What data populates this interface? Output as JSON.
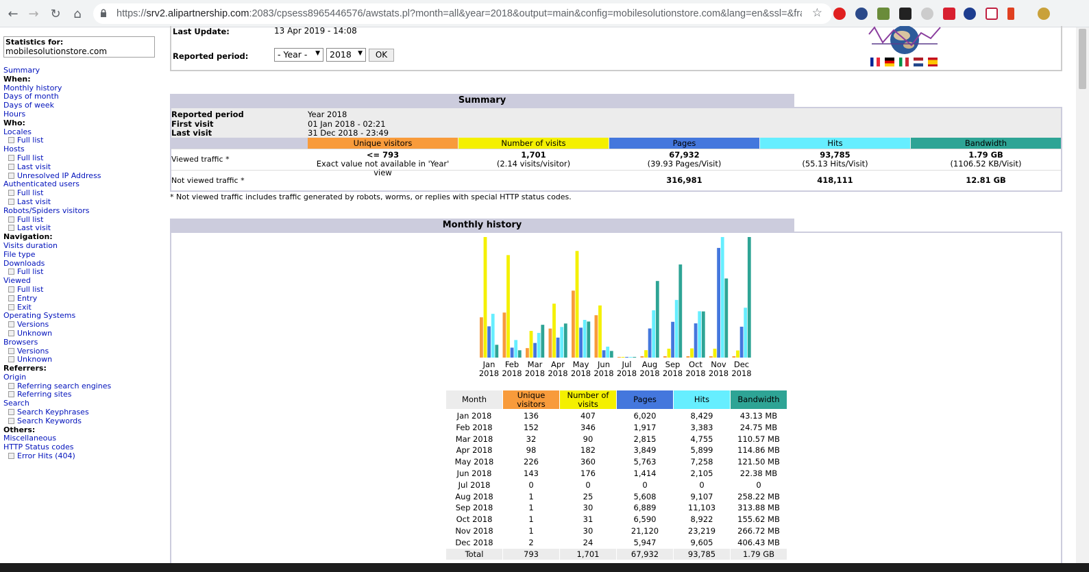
{
  "browser": {
    "url_prefix": "https://",
    "url_host": "srv2.alipartnership.com",
    "url_rest": ":2083/cpsess8965446576/awstats.pl?month=all&year=2018&output=main&config=mobilesolutionstore.com&lang=en&ssl=&fra..."
  },
  "menu": {
    "stats_for_label": "Statistics for:",
    "stats_for_value": "mobilesolutionstore.com",
    "items": [
      {
        "type": "link",
        "label": "Summary"
      },
      {
        "type": "head",
        "label": "When:"
      },
      {
        "type": "link",
        "label": "Monthly history"
      },
      {
        "type": "link",
        "label": "Days of month"
      },
      {
        "type": "link",
        "label": "Days of week"
      },
      {
        "type": "link",
        "label": "Hours"
      },
      {
        "type": "head",
        "label": "Who:"
      },
      {
        "type": "link",
        "label": "Locales"
      },
      {
        "type": "sub",
        "label": "Full list"
      },
      {
        "type": "link",
        "label": "Hosts"
      },
      {
        "type": "sub",
        "label": "Full list"
      },
      {
        "type": "sub",
        "label": "Last visit"
      },
      {
        "type": "sub",
        "label": "Unresolved IP Address"
      },
      {
        "type": "link",
        "label": "Authenticated users"
      },
      {
        "type": "sub",
        "label": "Full list"
      },
      {
        "type": "sub",
        "label": "Last visit"
      },
      {
        "type": "link",
        "label": "Robots/Spiders visitors"
      },
      {
        "type": "sub",
        "label": "Full list"
      },
      {
        "type": "sub",
        "label": "Last visit"
      },
      {
        "type": "head",
        "label": "Navigation:"
      },
      {
        "type": "link",
        "label": "Visits duration"
      },
      {
        "type": "link",
        "label": "File type"
      },
      {
        "type": "link",
        "label": "Downloads"
      },
      {
        "type": "sub",
        "label": "Full list"
      },
      {
        "type": "link",
        "label": "Viewed"
      },
      {
        "type": "sub",
        "label": "Full list"
      },
      {
        "type": "sub",
        "label": "Entry"
      },
      {
        "type": "sub",
        "label": "Exit"
      },
      {
        "type": "link",
        "label": "Operating Systems"
      },
      {
        "type": "sub",
        "label": "Versions"
      },
      {
        "type": "sub",
        "label": "Unknown"
      },
      {
        "type": "link",
        "label": "Browsers"
      },
      {
        "type": "sub",
        "label": "Versions"
      },
      {
        "type": "sub",
        "label": "Unknown"
      },
      {
        "type": "head",
        "label": "Referrers:"
      },
      {
        "type": "link",
        "label": "Origin"
      },
      {
        "type": "sub",
        "label": "Referring search engines"
      },
      {
        "type": "sub",
        "label": "Referring sites"
      },
      {
        "type": "link",
        "label": "Search"
      },
      {
        "type": "sub",
        "label": "Search Keyphrases"
      },
      {
        "type": "sub",
        "label": "Search Keywords"
      },
      {
        "type": "head",
        "label": "Others:"
      },
      {
        "type": "link",
        "label": "Miscellaneous"
      },
      {
        "type": "link",
        "label": "HTTP Status codes"
      },
      {
        "type": "sub",
        "label": "Error Hits (404)"
      }
    ]
  },
  "top": {
    "last_update_label": "Last Update:",
    "last_update_value": "13 Apr 2019 - 14:08",
    "reported_period_label": "Reported period:",
    "period_select": "- Year -",
    "year_select": "2018",
    "ok_label": "OK"
  },
  "summary": {
    "title": "Summary",
    "reported_period_label": "Reported period",
    "reported_period_value": "Year 2018",
    "first_visit_label": "First visit",
    "first_visit_value": "01 Jan 2018 - 02:21",
    "last_visit_label": "Last visit",
    "last_visit_value": "31 Dec 2018 - 23:49",
    "headers": [
      "Unique visitors",
      "Number of visits",
      "Pages",
      "Hits",
      "Bandwidth"
    ],
    "viewed_label": "Viewed traffic *",
    "viewed": [
      {
        "main": "<= 793",
        "sub": "Exact value not available in 'Year' view"
      },
      {
        "main": "1,701",
        "sub": "(2.14 visits/visitor)"
      },
      {
        "main": "67,932",
        "sub": "(39.93 Pages/Visit)"
      },
      {
        "main": "93,785",
        "sub": "(55.13 Hits/Visit)"
      },
      {
        "main": "1.79 GB",
        "sub": "(1106.52 KB/Visit)"
      }
    ],
    "not_viewed_label": "Not viewed traffic *",
    "not_viewed": [
      "316,981",
      "418,111",
      "12.81 GB"
    ],
    "footnote": "* Not viewed traffic includes traffic generated by robots, worms, or replies with special HTTP status codes."
  },
  "monthly": {
    "title": "Monthly history",
    "headers": [
      "Month",
      "Unique visitors",
      "Number of visits",
      "Pages",
      "Hits",
      "Bandwidth"
    ],
    "rows": [
      [
        "Jan 2018",
        "136",
        "407",
        "6,020",
        "8,429",
        "43.13 MB"
      ],
      [
        "Feb 2018",
        "152",
        "346",
        "1,917",
        "3,383",
        "24.75 MB"
      ],
      [
        "Mar 2018",
        "32",
        "90",
        "2,815",
        "4,755",
        "110.57 MB"
      ],
      [
        "Apr 2018",
        "98",
        "182",
        "3,849",
        "5,899",
        "114.86 MB"
      ],
      [
        "May 2018",
        "226",
        "360",
        "5,763",
        "7,258",
        "121.50 MB"
      ],
      [
        "Jun 2018",
        "143",
        "176",
        "1,414",
        "2,105",
        "22.38 MB"
      ],
      [
        "Jul 2018",
        "0",
        "0",
        "0",
        "0",
        "0"
      ],
      [
        "Aug 2018",
        "1",
        "25",
        "5,608",
        "9,107",
        "258.22 MB"
      ],
      [
        "Sep 2018",
        "1",
        "30",
        "6,889",
        "11,103",
        "313.88 MB"
      ],
      [
        "Oct 2018",
        "1",
        "31",
        "6,590",
        "8,922",
        "155.62 MB"
      ],
      [
        "Nov 2018",
        "1",
        "30",
        "21,120",
        "23,219",
        "266.72 MB"
      ],
      [
        "Dec 2018",
        "2",
        "24",
        "5,947",
        "9,605",
        "406.43 MB"
      ]
    ],
    "total": [
      "Total",
      "793",
      "1,701",
      "67,932",
      "93,785",
      "1.79 GB"
    ]
  },
  "colors": {
    "visitors": "#f89b3b",
    "visits": "#f4f000",
    "pages": "#4477dd",
    "hits": "#66eeff",
    "bandwidth": "#2ea495",
    "section": "#ccccdd",
    "link": "#0011bb"
  },
  "chart_data": {
    "type": "bar",
    "categories": [
      "Jan 2018",
      "Feb 2018",
      "Mar 2018",
      "Apr 2018",
      "May 2018",
      "Jun 2018",
      "Jul 2018",
      "Aug 2018",
      "Sep 2018",
      "Oct 2018",
      "Nov 2018",
      "Dec 2018"
    ],
    "x_tick_months": [
      "Jan",
      "Feb",
      "Mar",
      "Apr",
      "May",
      "Jun",
      "Jul",
      "Aug",
      "Sep",
      "Oct",
      "Nov",
      "Dec"
    ],
    "x_tick_year": "2018",
    "series": [
      {
        "name": "Unique visitors",
        "values": [
          136,
          152,
          32,
          98,
          226,
          143,
          0,
          1,
          1,
          1,
          1,
          2
        ]
      },
      {
        "name": "Number of visits",
        "values": [
          407,
          346,
          90,
          182,
          360,
          176,
          0,
          25,
          30,
          31,
          30,
          24
        ]
      },
      {
        "name": "Pages",
        "values": [
          6020,
          1917,
          2815,
          3849,
          5763,
          1414,
          0,
          5608,
          6889,
          6590,
          21120,
          5947
        ]
      },
      {
        "name": "Hits",
        "values": [
          8429,
          3383,
          4755,
          5899,
          7258,
          2105,
          0,
          9107,
          11103,
          8922,
          23219,
          9605
        ]
      },
      {
        "name": "Bandwidth",
        "values": [
          43.13,
          24.75,
          110.57,
          114.86,
          121.5,
          22.38,
          0,
          258.22,
          313.88,
          155.62,
          266.72,
          406.43
        ]
      }
    ]
  }
}
